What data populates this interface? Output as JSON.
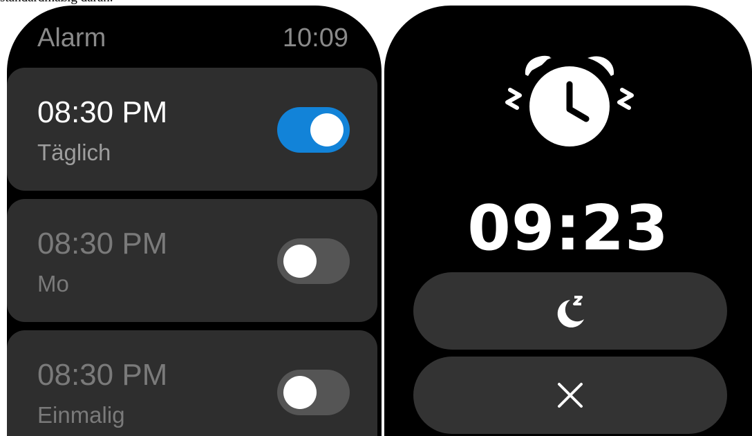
{
  "cut_text": "standardmäßig daran.",
  "left_watch": {
    "header": {
      "title": "Alarm",
      "time": "10:09"
    },
    "alarms": [
      {
        "time": "08:30 PM",
        "repeat": "Täglich",
        "enabled": true
      },
      {
        "time": "08:30 PM",
        "repeat": "Mo",
        "enabled": false
      },
      {
        "time": "08:30 PM",
        "repeat": "Einmalig",
        "enabled": false
      }
    ]
  },
  "right_watch": {
    "icon": "alarm-clock-ringing-icon",
    "time": "09:23",
    "buttons": [
      {
        "icon": "snooze-moon-icon"
      },
      {
        "icon": "close-icon"
      }
    ]
  },
  "colors": {
    "background": "#000000",
    "card": "#2e2e2e",
    "toggle_on": "#1283d8",
    "toggle_off": "#555555",
    "button": "#333333"
  }
}
